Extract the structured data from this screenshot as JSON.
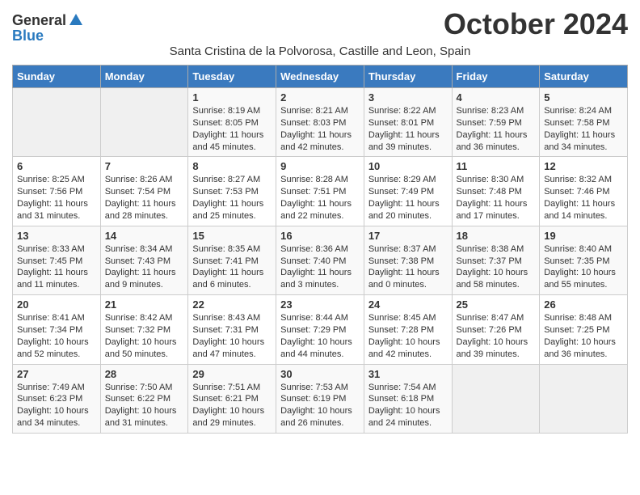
{
  "header": {
    "logo_general": "General",
    "logo_blue": "Blue",
    "month_title": "October 2024",
    "location": "Santa Cristina de la Polvorosa, Castille and Leon, Spain"
  },
  "days_of_week": [
    "Sunday",
    "Monday",
    "Tuesday",
    "Wednesday",
    "Thursday",
    "Friday",
    "Saturday"
  ],
  "weeks": [
    [
      {
        "day": "",
        "sunrise": "",
        "sunset": "",
        "daylight": ""
      },
      {
        "day": "",
        "sunrise": "",
        "sunset": "",
        "daylight": ""
      },
      {
        "day": "1",
        "sunrise": "Sunrise: 8:19 AM",
        "sunset": "Sunset: 8:05 PM",
        "daylight": "Daylight: 11 hours and 45 minutes."
      },
      {
        "day": "2",
        "sunrise": "Sunrise: 8:21 AM",
        "sunset": "Sunset: 8:03 PM",
        "daylight": "Daylight: 11 hours and 42 minutes."
      },
      {
        "day": "3",
        "sunrise": "Sunrise: 8:22 AM",
        "sunset": "Sunset: 8:01 PM",
        "daylight": "Daylight: 11 hours and 39 minutes."
      },
      {
        "day": "4",
        "sunrise": "Sunrise: 8:23 AM",
        "sunset": "Sunset: 7:59 PM",
        "daylight": "Daylight: 11 hours and 36 minutes."
      },
      {
        "day": "5",
        "sunrise": "Sunrise: 8:24 AM",
        "sunset": "Sunset: 7:58 PM",
        "daylight": "Daylight: 11 hours and 34 minutes."
      }
    ],
    [
      {
        "day": "6",
        "sunrise": "Sunrise: 8:25 AM",
        "sunset": "Sunset: 7:56 PM",
        "daylight": "Daylight: 11 hours and 31 minutes."
      },
      {
        "day": "7",
        "sunrise": "Sunrise: 8:26 AM",
        "sunset": "Sunset: 7:54 PM",
        "daylight": "Daylight: 11 hours and 28 minutes."
      },
      {
        "day": "8",
        "sunrise": "Sunrise: 8:27 AM",
        "sunset": "Sunset: 7:53 PM",
        "daylight": "Daylight: 11 hours and 25 minutes."
      },
      {
        "day": "9",
        "sunrise": "Sunrise: 8:28 AM",
        "sunset": "Sunset: 7:51 PM",
        "daylight": "Daylight: 11 hours and 22 minutes."
      },
      {
        "day": "10",
        "sunrise": "Sunrise: 8:29 AM",
        "sunset": "Sunset: 7:49 PM",
        "daylight": "Daylight: 11 hours and 20 minutes."
      },
      {
        "day": "11",
        "sunrise": "Sunrise: 8:30 AM",
        "sunset": "Sunset: 7:48 PM",
        "daylight": "Daylight: 11 hours and 17 minutes."
      },
      {
        "day": "12",
        "sunrise": "Sunrise: 8:32 AM",
        "sunset": "Sunset: 7:46 PM",
        "daylight": "Daylight: 11 hours and 14 minutes."
      }
    ],
    [
      {
        "day": "13",
        "sunrise": "Sunrise: 8:33 AM",
        "sunset": "Sunset: 7:45 PM",
        "daylight": "Daylight: 11 hours and 11 minutes."
      },
      {
        "day": "14",
        "sunrise": "Sunrise: 8:34 AM",
        "sunset": "Sunset: 7:43 PM",
        "daylight": "Daylight: 11 hours and 9 minutes."
      },
      {
        "day": "15",
        "sunrise": "Sunrise: 8:35 AM",
        "sunset": "Sunset: 7:41 PM",
        "daylight": "Daylight: 11 hours and 6 minutes."
      },
      {
        "day": "16",
        "sunrise": "Sunrise: 8:36 AM",
        "sunset": "Sunset: 7:40 PM",
        "daylight": "Daylight: 11 hours and 3 minutes."
      },
      {
        "day": "17",
        "sunrise": "Sunrise: 8:37 AM",
        "sunset": "Sunset: 7:38 PM",
        "daylight": "Daylight: 11 hours and 0 minutes."
      },
      {
        "day": "18",
        "sunrise": "Sunrise: 8:38 AM",
        "sunset": "Sunset: 7:37 PM",
        "daylight": "Daylight: 10 hours and 58 minutes."
      },
      {
        "day": "19",
        "sunrise": "Sunrise: 8:40 AM",
        "sunset": "Sunset: 7:35 PM",
        "daylight": "Daylight: 10 hours and 55 minutes."
      }
    ],
    [
      {
        "day": "20",
        "sunrise": "Sunrise: 8:41 AM",
        "sunset": "Sunset: 7:34 PM",
        "daylight": "Daylight: 10 hours and 52 minutes."
      },
      {
        "day": "21",
        "sunrise": "Sunrise: 8:42 AM",
        "sunset": "Sunset: 7:32 PM",
        "daylight": "Daylight: 10 hours and 50 minutes."
      },
      {
        "day": "22",
        "sunrise": "Sunrise: 8:43 AM",
        "sunset": "Sunset: 7:31 PM",
        "daylight": "Daylight: 10 hours and 47 minutes."
      },
      {
        "day": "23",
        "sunrise": "Sunrise: 8:44 AM",
        "sunset": "Sunset: 7:29 PM",
        "daylight": "Daylight: 10 hours and 44 minutes."
      },
      {
        "day": "24",
        "sunrise": "Sunrise: 8:45 AM",
        "sunset": "Sunset: 7:28 PM",
        "daylight": "Daylight: 10 hours and 42 minutes."
      },
      {
        "day": "25",
        "sunrise": "Sunrise: 8:47 AM",
        "sunset": "Sunset: 7:26 PM",
        "daylight": "Daylight: 10 hours and 39 minutes."
      },
      {
        "day": "26",
        "sunrise": "Sunrise: 8:48 AM",
        "sunset": "Sunset: 7:25 PM",
        "daylight": "Daylight: 10 hours and 36 minutes."
      }
    ],
    [
      {
        "day": "27",
        "sunrise": "Sunrise: 7:49 AM",
        "sunset": "Sunset: 6:23 PM",
        "daylight": "Daylight: 10 hours and 34 minutes."
      },
      {
        "day": "28",
        "sunrise": "Sunrise: 7:50 AM",
        "sunset": "Sunset: 6:22 PM",
        "daylight": "Daylight: 10 hours and 31 minutes."
      },
      {
        "day": "29",
        "sunrise": "Sunrise: 7:51 AM",
        "sunset": "Sunset: 6:21 PM",
        "daylight": "Daylight: 10 hours and 29 minutes."
      },
      {
        "day": "30",
        "sunrise": "Sunrise: 7:53 AM",
        "sunset": "Sunset: 6:19 PM",
        "daylight": "Daylight: 10 hours and 26 minutes."
      },
      {
        "day": "31",
        "sunrise": "Sunrise: 7:54 AM",
        "sunset": "Sunset: 6:18 PM",
        "daylight": "Daylight: 10 hours and 24 minutes."
      },
      {
        "day": "",
        "sunrise": "",
        "sunset": "",
        "daylight": ""
      },
      {
        "day": "",
        "sunrise": "",
        "sunset": "",
        "daylight": ""
      }
    ]
  ]
}
